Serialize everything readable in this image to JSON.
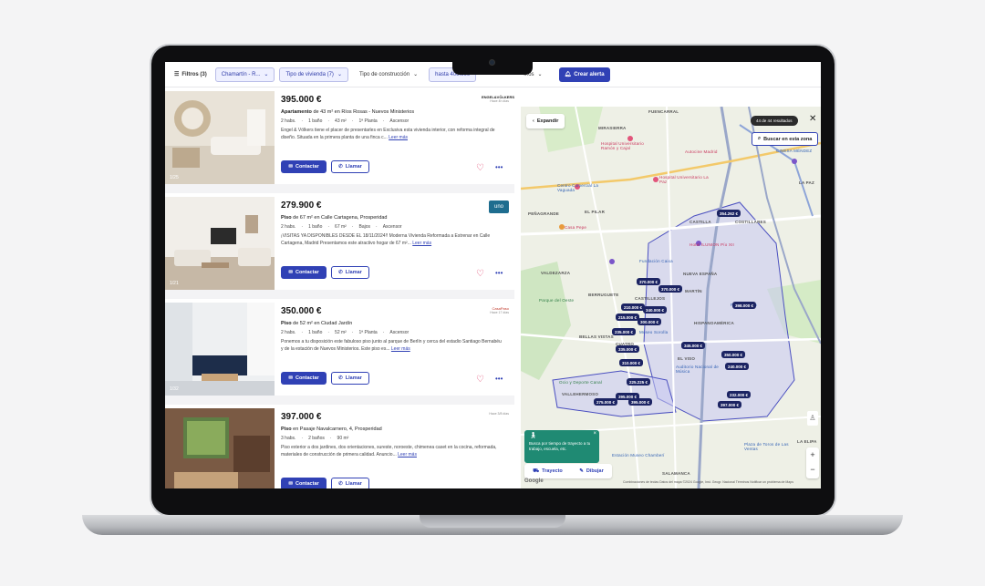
{
  "filterbar": {
    "filters_label": "Filtros (3)",
    "chips": [
      {
        "label": "Chamartín - R...",
        "active": true
      },
      {
        "label": "Tipo de vivienda (7)",
        "active": true
      },
      {
        "label": "Tipo de construcción",
        "active": false
      },
      {
        "label": "hasta 400.000",
        "active": true
      },
      {
        "label": "...os",
        "active": false
      }
    ],
    "alert_label": "Crear alerta"
  },
  "listings": [
    {
      "price": "395.000 €",
      "type": "Apartamento",
      "title_rest": " de 43 m² en Ríos Rosas - Nuevos Ministerios",
      "features": [
        "2 habs.",
        "1 baño",
        "43 m²",
        "1ª Planta",
        "Ascensor"
      ],
      "description": "Engel & Völkers tiene el placer de presentarles en Exclusiva esta vivienda interior, con reforma integral de diseño. Situada en la primera planta de una finca c...",
      "read_more": "Leer más",
      "photo_counter": "1/25",
      "logo_text": "ENGEL&VÖLKERS",
      "logo_note": "Hace 4h días"
    },
    {
      "price": "279.900 €",
      "type": "Piso",
      "title_rest": " de 67 m² en Calle Cartagena, Prosperidad",
      "features": [
        "2 habs.",
        "1 baño",
        "67 m²",
        "Bajos",
        "Ascensor"
      ],
      "description": "¡VISITAS YA DISPONIBLES DESDE EL 18/11/2024!! Moderna Vivienda Reformada a Estrenar en Calle Cartagena, Madrid Presentamos este atractivo hogar de 67 m²...",
      "read_more": "Leer más",
      "photo_counter": "1/21",
      "logo_text": "uno",
      "logo_note": ""
    },
    {
      "price": "350.000 €",
      "type": "Piso",
      "title_rest": " de 52 m² en Ciudad Jardín",
      "features": [
        "2 habs.",
        "1 baño",
        "52 m²",
        "1ª Planta",
        "Ascensor"
      ],
      "description": "Ponemos a tu disposición este fabuloso piso junto al parque de Berlín y cerca del estadio Santiago Bernabéu y de la estación de Nuevos Ministerios. Este piso es...",
      "read_more": "Leer más",
      "photo_counter": "1/32",
      "logo_text": "CasaPaso",
      "logo_note": "Hace 17 días"
    },
    {
      "price": "397.000 €",
      "type": "Piso",
      "title_rest": " en Pasaje Navalcarnero, 4, Prosperidad",
      "features": [
        "3 habs.",
        "2 baños",
        "90 m²"
      ],
      "description": "Piso exterior a dos jardines, dos orientaciones, sureste, noroeste, chimenea caset en la cocina, reformada, materiales de construcción de primera calidad. Anuncio...",
      "read_more": "Leer más",
      "photo_counter": "",
      "logo_text": "",
      "logo_note": "Hace 3/8 días"
    }
  ],
  "actions": {
    "contact": "Contactar",
    "call": "Llamar"
  },
  "map": {
    "expand_label": "Expandir",
    "results": "44 de 44 resultados",
    "search_zone": "Buscar en esta zona",
    "trip_tooltip": "Busca por tiempo de trayecto a tu trabajo, escuela, etc.",
    "trip_label": "Trayecto",
    "draw_label": "Dibujar",
    "attribution": "Combinaciones de teclas   Datos del mapa ©2024 Google, Inst. Geogr. Nacional   Términos   Notificar un problema de Maps",
    "google": "Google",
    "price_tags": [
      "354.262 €",
      "370.000 €",
      "370.000 €",
      "210.000 €",
      "340.000 €",
      "215.000 €",
      "300.000 €",
      "398.000 €",
      "235.000 €",
      "335.000 €",
      "345.000 €",
      "310.000 €",
      "350.000 €",
      "240.000 €",
      "225.225 €",
      "395.000 €",
      "275.000 €",
      "395.000 €",
      "232.000 €",
      "397.000 €"
    ],
    "labels": {
      "fuencarral": "FUENCARRAL",
      "mirasierra": "MIRASIERRA",
      "castilla": "CASTILLA",
      "el_pilar": "EL PILAR",
      "penagrande": "PEÑAGRANDE",
      "valdezarza": "VALDEZARZA",
      "berruguete": "BERRUGUETE",
      "castillejos": "CASTILLEJOS",
      "nueva_espana": "NUEVA ESPAÑA",
      "bellas_vistas": "BELLAS VISTAS",
      "cuatro_caminos": "CUATRO",
      "hispanoamerica": "HISPANOAMÉRICA",
      "el_viso": "EL VISO",
      "vallehermoso": "VALLEHERMOSO",
      "almagro": "ALMAGRO",
      "salamanca": "SALAMANCA",
      "la_paz": "LA PAZ",
      "costillares": "COSTILLARES",
      "la_elipa": "LA ELIPA",
      "canal": "CANAL",
      "martin": "MARTÍN"
    },
    "pois": {
      "hospital_ramon": "Hospital Universitario Ramón y Cajal",
      "hospital_la_paz": "Hospital Universitario La Paz",
      "autocine": "Autocine Madrid",
      "cinesa": "CINESA MÉNDEZ",
      "centro_comercial": "Centro Comercial La Vaguada",
      "casa_pepe": "Casa Pepe",
      "fundacion": "Fundación Caixa",
      "hotel_illunion": "Hotel ILUNION Pío XII",
      "auditorio": "Auditorio Nacional de Música",
      "estacion": "Estación Museo Chamberí",
      "plaza_toros": "Plaza de Toros de Las Ventas",
      "parque_oeste": "Parque del Oeste",
      "canal_isabel": "Ocio y Deporte Canal",
      "museo_sorolla": "Museo Sorolla",
      "circular_palacio": "Plaza Nación"
    }
  },
  "colors": {
    "accent": "#3041b5",
    "map_tag": "#1c2463",
    "heart": "#e0406b",
    "tooltip": "#1f8a73"
  }
}
